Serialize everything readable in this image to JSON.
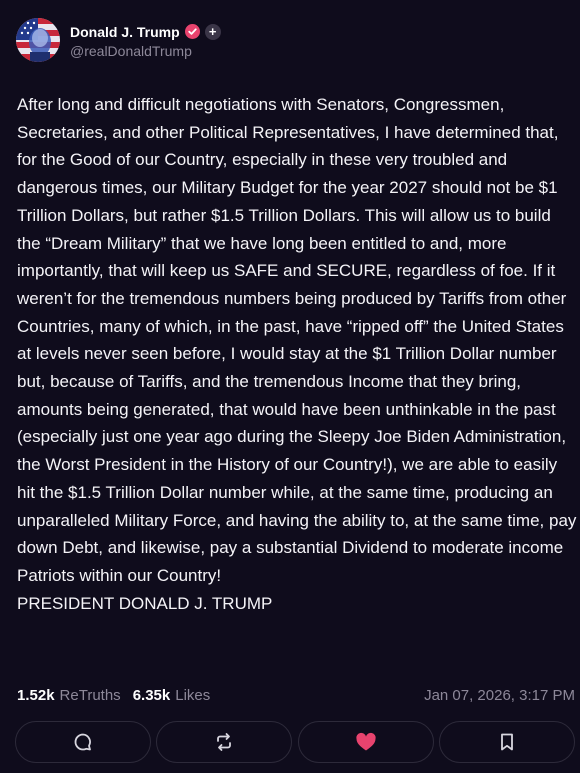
{
  "author": {
    "display_name": "Donald J. Trump",
    "handle": "@realDonaldTrump",
    "verified_color": "#e8436e"
  },
  "post": {
    "text": "After long and difficult negotiations with Senators, Congressmen, Secretaries, and other Political Representatives, I have determined that, for the Good of our Country, especially in these very troubled and dangerous times, our Military Budget for the year 2027 should not be $1 Trillion Dollars, but rather $1.5 Trillion Dollars. This will allow us to build the “Dream Military” that we have long been entitled to and, more importantly, that will keep us SAFE and SECURE, regardless of foe. If it weren’t for the tremendous numbers being produced by Tariffs from other Countries, many of which, in the past, have “ripped off” the United States at levels never seen before, I would stay at the $1 Trillion Dollar number but, because of Tariffs, and the tremendous Income that they bring, amounts being generated, that would have been unthinkable in the past (especially just one year ago during the Sleepy Joe Biden Administration, the Worst President in the History of our Country!), we are able to easily hit the $1.5 Trillion Dollar number while, at the same time, producing an unparalleled Military Force, and having the ability to, at the same time, pay down Debt, and likewise, pay a substantial Dividend to moderate income Patriots within our Country!\nPRESIDENT DONALD J. TRUMP"
  },
  "stats": {
    "retruths_count": "1.52k",
    "retruths_label": "ReTruths",
    "likes_count": "6.35k",
    "likes_label": "Likes",
    "timestamp": "Jan 07, 2026, 3:17 PM"
  },
  "actions": {
    "reply_icon": "comment-icon",
    "retruth_icon": "retruth-icon",
    "like_icon": "heart-icon",
    "like_active_color": "#e8436e",
    "bookmark_icon": "bookmark-icon"
  }
}
